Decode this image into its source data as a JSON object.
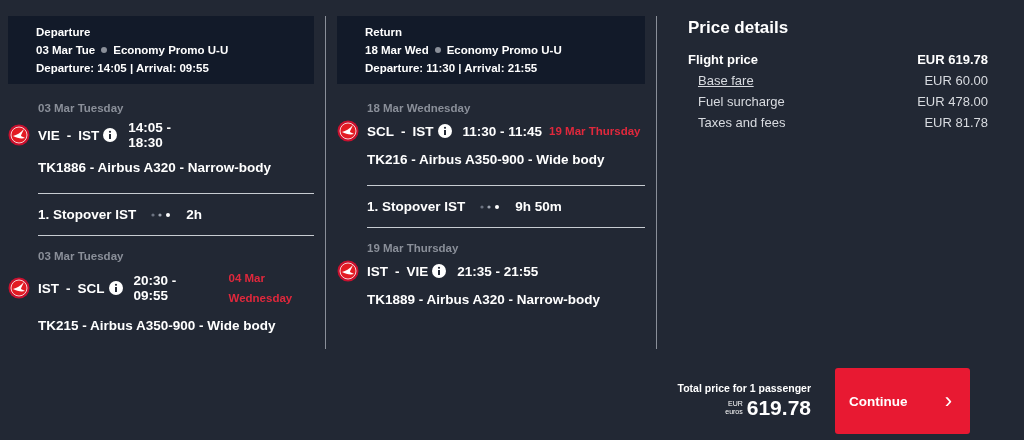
{
  "journeys": [
    {
      "heading": "Departure",
      "date": "03 Mar Tue",
      "fare_class": "Economy Promo U-U",
      "times": "Departure: 14:05 | Arrival: 09:55",
      "items": [
        {
          "kind": "flight",
          "date": "03 Mar Tuesday",
          "origin": "VIE",
          "dash": "-",
          "destination": "IST",
          "times": "14:05 - 18:30",
          "aircraft": "TK1886 - Airbus A320 - Narrow-body"
        },
        {
          "kind": "stopover",
          "label": "1. Stopover IST",
          "duration": "2h"
        },
        {
          "kind": "flight",
          "date": "03 Mar Tuesday",
          "origin": "IST",
          "dash": "-",
          "destination": "SCL",
          "times": "20:30 - 09:55",
          "arrival_date": "04 Mar Wednesday",
          "aircraft": "TK215 - Airbus A350-900 - Wide body"
        }
      ]
    },
    {
      "heading": "Return",
      "date": "18 Mar Wed",
      "fare_class": "Economy Promo U-U",
      "times": "Departure: 11:30 | Arrival: 21:55",
      "items": [
        {
          "kind": "flight",
          "date": "18 Mar Wednesday",
          "origin": "SCL",
          "dash": "-",
          "destination": "IST",
          "times": "11:30 - 11:45",
          "arrival_date": "19 Mar Thursday",
          "aircraft": "TK216 - Airbus A350-900 - Wide body"
        },
        {
          "kind": "stopover",
          "label": "1. Stopover IST",
          "duration": "9h 50m"
        },
        {
          "kind": "flight",
          "date": "19 Mar Thursday",
          "origin": "IST",
          "dash": "-",
          "destination": "VIE",
          "times": "21:35 - 21:55",
          "aircraft": "TK1889 - Airbus A320 - Narrow-body"
        }
      ]
    }
  ],
  "price_details": {
    "title": "Price details",
    "rows": [
      {
        "kind": "total",
        "label": "Flight price",
        "amount": "EUR 619.78"
      },
      {
        "kind": "link",
        "label": "Base fare",
        "amount": "EUR 60.00"
      },
      {
        "kind": "item",
        "label": "Fuel surcharge",
        "amount": "EUR 478.00"
      },
      {
        "kind": "item",
        "label": "Taxes and fees",
        "amount": "EUR 81.78"
      }
    ]
  },
  "footer": {
    "caption": "Total price for 1 passenger",
    "currency": "EUR",
    "currency_word": "euros",
    "amount": "619.78",
    "button": "Continue",
    "button_icon": "›"
  }
}
